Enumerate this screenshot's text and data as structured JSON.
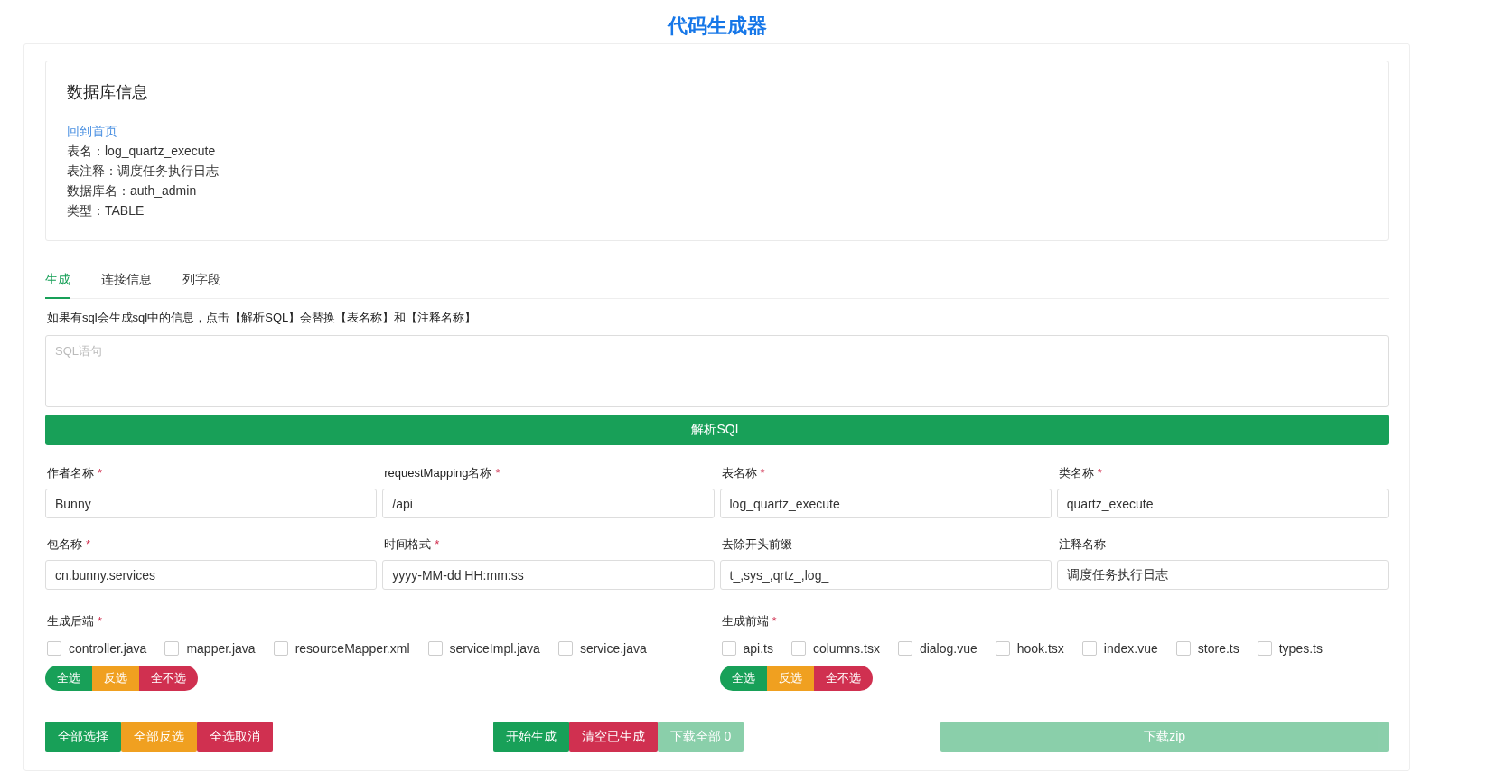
{
  "title": "代码生成器",
  "info": {
    "heading": "数据库信息",
    "link": "回到首页",
    "lines": [
      "表名：log_quartz_execute",
      "表注释：调度任务执行日志",
      "数据库名：auth_admin",
      "类型：TABLE"
    ]
  },
  "tabs": [
    {
      "label": "生成",
      "selected": true
    },
    {
      "label": "连接信息",
      "selected": false
    },
    {
      "label": "列字段",
      "selected": false
    }
  ],
  "hint": "如果有sql会生成sql中的信息，点击【解析SQL】会替换【表名称】和【注释名称】",
  "sql": {
    "placeholder": "SQL语句"
  },
  "parse_button": "解析SQL",
  "fields": [
    {
      "label": "作者名称",
      "mark": "*",
      "value": "Bunny"
    },
    {
      "label": "requestMapping名称",
      "mark": "*",
      "value": "/api"
    },
    {
      "label": "表名称",
      "mark": "*",
      "value": "log_quartz_execute"
    },
    {
      "label": "类名称",
      "mark": "*",
      "value": "quartz_execute"
    },
    {
      "label": "包名称",
      "mark": "*",
      "value": "cn.bunny.services"
    },
    {
      "label": "时间格式",
      "mark": "*",
      "value": "yyyy-MM-dd HH:mm:ss"
    },
    {
      "label": "去除开头前缀",
      "value": "t_,sys_,qrtz_,log_"
    },
    {
      "label": "注释名称",
      "value": "调度任务执行日志"
    }
  ],
  "groups": [
    {
      "label": "生成后端",
      "mark": "*",
      "options": [
        {
          "label": "controller.java",
          "checked": false
        },
        {
          "label": "mapper.java",
          "checked": false
        },
        {
          "label": "resourceMapper.xml",
          "checked": false
        },
        {
          "label": "serviceImpl.java",
          "checked": false
        },
        {
          "label": "service.java",
          "checked": false
        }
      ],
      "buttons": [
        {
          "label": "全选",
          "kind": "success"
        },
        {
          "label": "反选",
          "kind": "warning"
        },
        {
          "label": "全不选",
          "kind": "danger"
        }
      ]
    },
    {
      "label": "生成前端",
      "mark": "*",
      "options": [
        {
          "label": "api.ts",
          "checked": false
        },
        {
          "label": "columns.tsx",
          "checked": false
        },
        {
          "label": "dialog.vue",
          "checked": false
        },
        {
          "label": "hook.tsx",
          "checked": false
        },
        {
          "label": "index.vue",
          "checked": false
        },
        {
          "label": "store.ts",
          "checked": false
        },
        {
          "label": "types.ts",
          "checked": false
        }
      ],
      "buttons": [
        {
          "label": "全选",
          "kind": "success"
        },
        {
          "label": "反选",
          "kind": "warning"
        },
        {
          "label": "全不选",
          "kind": "danger"
        }
      ]
    }
  ],
  "footer": [
    [
      {
        "label": "全部选择",
        "kind": "success",
        "disabled": false
      },
      {
        "label": "全部反选",
        "kind": "warning",
        "disabled": false
      },
      {
        "label": "全选取消",
        "kind": "danger",
        "disabled": false
      }
    ],
    [
      {
        "label": "开始生成",
        "kind": "success",
        "disabled": false
      },
      {
        "label": "清空已生成",
        "kind": "danger",
        "disabled": false
      },
      {
        "label": "下载全部 0",
        "kind": "success",
        "disabled": true
      }
    ],
    [
      {
        "label": "下载zip",
        "kind": "success",
        "disabled": true
      }
    ]
  ]
}
